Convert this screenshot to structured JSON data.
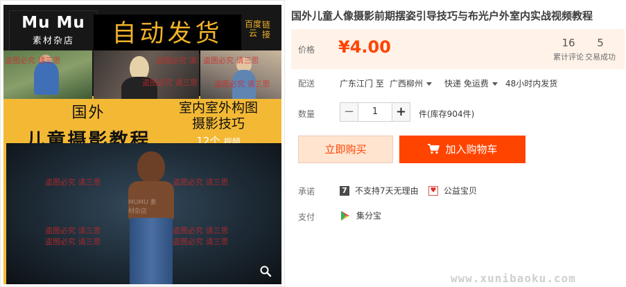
{
  "poster": {
    "brand_name": "Mu Mu",
    "brand_shop": "素材杂店",
    "banner": "自动发货",
    "cloud": "百度云",
    "link": "链接",
    "watermark": "盗图必究 请三思",
    "title_left_line1": "国外",
    "title_left_line2": "儿童摄影教程",
    "title_right_line1": "室内室外构图",
    "title_right_line2": "摄影技巧",
    "count_number": "12个",
    "count_unit": "视频",
    "kid_watermark": "MUMU 素材杂店",
    "zoom_icon": "magnifier-icon"
  },
  "product": {
    "title": "国外儿童人像摄影前期摆姿引导技巧与布光户外室内实战视频教程"
  },
  "price": {
    "label": "价格",
    "value": "¥4.00",
    "accent_color": "#ff4400",
    "reviews_count": "16",
    "reviews_label": "累计评论",
    "sales_count": "5",
    "sales_label": "交易成功"
  },
  "shipping": {
    "label": "配送",
    "from_to": "广东江门 至",
    "destination": "广西柳州",
    "method": "快递 免运费",
    "dispatch": "48小时内发货"
  },
  "quantity": {
    "label": "数量",
    "minus": "−",
    "value": "1",
    "plus": "+",
    "stock": "件(库存904件)"
  },
  "actions": {
    "buy_now": "立即购买",
    "add_to_cart": "加入购物车",
    "cart_icon": "shopping-cart-icon"
  },
  "promise": {
    "label": "承诺",
    "item1_icon": "7",
    "item1_text": "不支持7天无理由",
    "item2_icon": "heart-icon",
    "item2_text": "公益宝贝"
  },
  "payment": {
    "label": "支付",
    "method": "集分宝",
    "icon": "play-logo-icon"
  },
  "site_watermark": "www.xunibaoku.com"
}
